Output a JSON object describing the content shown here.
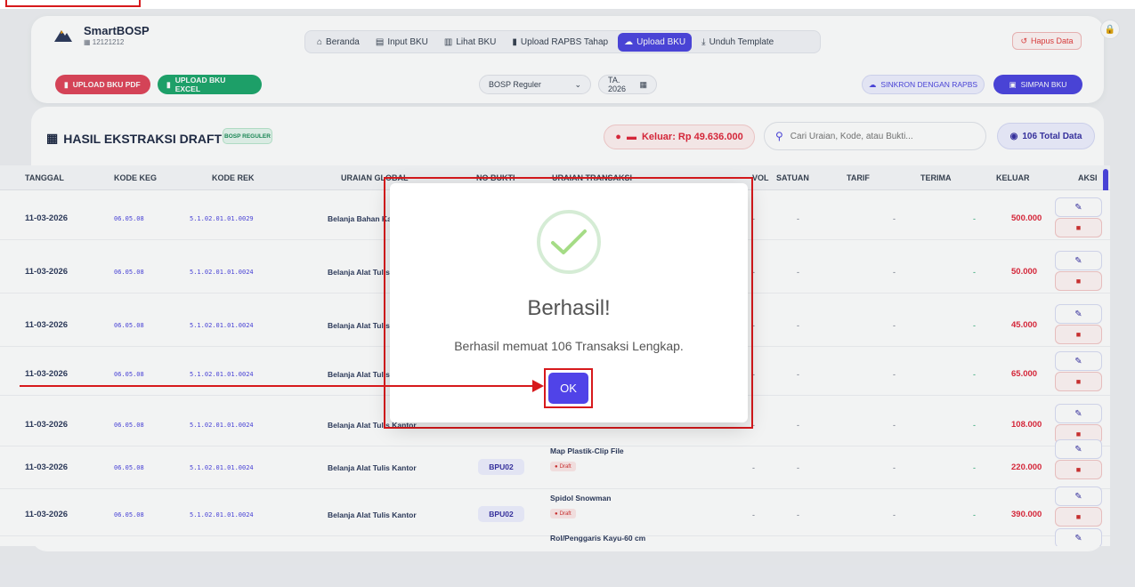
{
  "app": {
    "name": "SmartBOSP",
    "npsn": "12121212"
  },
  "nav": {
    "items": [
      {
        "label": "Beranda",
        "icon": "home-icon"
      },
      {
        "label": "Input BKU",
        "icon": "keyboard-icon"
      },
      {
        "label": "Lihat BKU",
        "icon": "book-icon"
      },
      {
        "label": "Upload RAPBS Tahap",
        "icon": "file-icon"
      },
      {
        "label": "Upload BKU",
        "icon": "cloud-upload-icon",
        "active": true
      },
      {
        "label": "Unduh Template",
        "icon": "download-icon"
      }
    ]
  },
  "toolbar": {
    "hapus": "Hapus Data",
    "upload_pdf": "UPLOAD BKU PDF",
    "upload_excel": "UPLOAD BKU EXCEL",
    "sumber_dana": "BOSP Reguler",
    "tahun": "TA. 2026",
    "sinkron": "SINKRON DENGAN RAPBS",
    "simpan": "SIMPAN BKU"
  },
  "section": {
    "title": "HASIL EKSTRAKSI DRAFT",
    "badge": "BOSP REGULER",
    "keluar": "Keluar: Rp 49.636.000",
    "search_placeholder": "Cari Uraian, Kode, atau Bukti...",
    "total": "106 Total Data"
  },
  "table": {
    "headers": {
      "tanggal": "TANGGAL",
      "kode_keg": "KODE KEG",
      "kode_rek": "KODE REK",
      "uraian_global": "URAIAN GLOBAL",
      "no_bukti": "NO BUKTI",
      "uraian_transaksi": "URAIAN TRANSAKSI",
      "vol": "VOL",
      "satuan": "SATUAN",
      "tarif": "TARIF",
      "terima": "TERIMA",
      "keluar": "KELUAR",
      "aksi": "AKSI"
    },
    "draft_label": "Draft",
    "rows": [
      {
        "tanggal": "11-03-2026",
        "kode_keg": "06.05.08",
        "kode_rek": "5.1.02.01.01.0029",
        "uraian": "Belanja Bahan Kantor",
        "bukti": "",
        "transaksi": "",
        "vol": "-",
        "satuan": "-",
        "tarif": "-",
        "terima": "-",
        "keluar": "500.000"
      },
      {
        "tanggal": "11-03-2026",
        "kode_keg": "06.05.08",
        "kode_rek": "5.1.02.01.01.0024",
        "uraian": "Belanja Alat Tulis Kantor",
        "bukti": "",
        "transaksi": "",
        "vol": "-",
        "satuan": "-",
        "tarif": "-",
        "terima": "-",
        "keluar": "50.000"
      },
      {
        "tanggal": "11-03-2026",
        "kode_keg": "06.05.08",
        "kode_rek": "5.1.02.01.01.0024",
        "uraian": "Belanja Alat Tulis Kantor",
        "bukti": "",
        "transaksi": "",
        "vol": "-",
        "satuan": "-",
        "tarif": "-",
        "terima": "-",
        "keluar": "45.000"
      },
      {
        "tanggal": "11-03-2026",
        "kode_keg": "06.05.08",
        "kode_rek": "5.1.02.01.01.0024",
        "uraian": "Belanja Alat Tulis Kantor",
        "bukti": "",
        "transaksi": "",
        "vol": "-",
        "satuan": "-",
        "tarif": "-",
        "terima": "-",
        "keluar": "65.000"
      },
      {
        "tanggal": "11-03-2026",
        "kode_keg": "06.05.08",
        "kode_rek": "5.1.02.01.01.0024",
        "uraian": "Belanja Alat Tulis Kantor",
        "bukti": "",
        "transaksi": "",
        "vol": "-",
        "satuan": "-",
        "tarif": "-",
        "terima": "-",
        "keluar": "108.000"
      },
      {
        "tanggal": "11-03-2026",
        "kode_keg": "06.05.08",
        "kode_rek": "5.1.02.01.01.0024",
        "uraian": "Belanja Alat Tulis Kantor",
        "bukti": "BPU02",
        "transaksi": "Map Plastik-Clip File",
        "vol": "-",
        "satuan": "-",
        "tarif": "-",
        "terima": "-",
        "keluar": "220.000"
      },
      {
        "tanggal": "11-03-2026",
        "kode_keg": "06.05.08",
        "kode_rek": "5.1.02.01.01.0024",
        "uraian": "Belanja Alat Tulis Kantor",
        "bukti": "BPU02",
        "transaksi": "Spidol Snowman",
        "vol": "-",
        "satuan": "-",
        "tarif": "-",
        "terima": "-",
        "keluar": "390.000"
      },
      {
        "tanggal": "",
        "kode_keg": "",
        "kode_rek": "",
        "uraian": "",
        "bukti": "",
        "transaksi": "Rol/Penggaris Kayu-60 cm",
        "vol": "",
        "satuan": "",
        "tarif": "",
        "terima": "",
        "keluar": ""
      }
    ]
  },
  "modal": {
    "title": "Berhasil!",
    "message": "Berhasil memuat 106 Transaksi Lengkap.",
    "ok": "OK"
  },
  "colors": {
    "primary": "#4c44e0",
    "danger": "#e0263a",
    "success": "#1da66c",
    "annotation": "#d7191c"
  }
}
